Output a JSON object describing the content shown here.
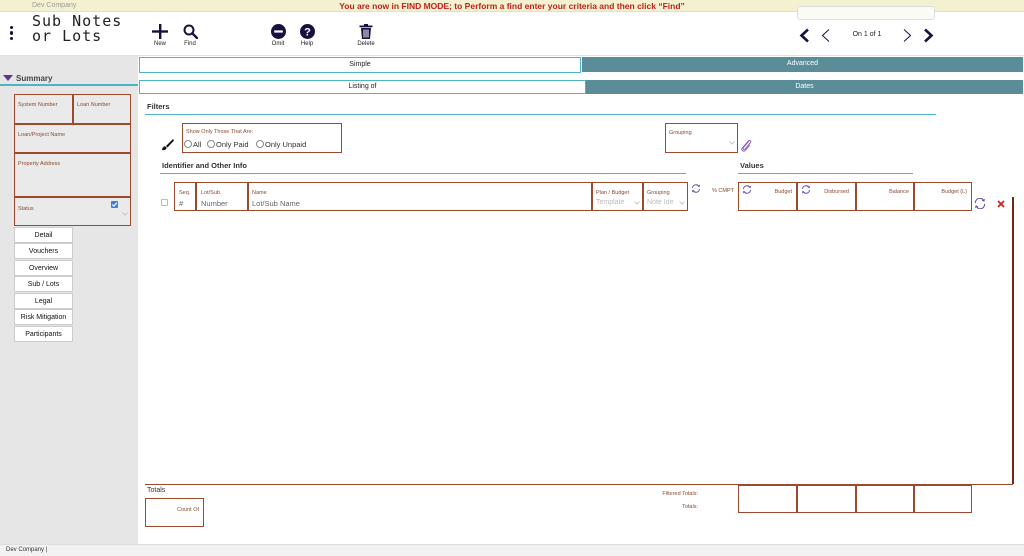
{
  "banner": {
    "company": "Dev Company",
    "find_message": "You are now in FIND MODE; to Perform a find enter your criteria and then click “Find”"
  },
  "toolbar": {
    "title_line1": "Sub Notes",
    "title_line2": "or Lots",
    "new_label": "New",
    "find_label": "Find",
    "omit_label": "Omit",
    "help_label": "Help",
    "delete_label": "Delete",
    "pager_text": "On 1 of 1"
  },
  "sidebar": {
    "summary_label": "Summary",
    "fields": {
      "system_number": "System Number",
      "loan_number": "Loan Number",
      "project_name": "Loan/Project Name",
      "property_address": "Property Address",
      "status": "Status"
    },
    "nav": [
      "Detail",
      "Vouchers",
      "Overview",
      "Sub / Lots",
      "Legal",
      "Risk Mitigation",
      "Participants"
    ]
  },
  "tabs": {
    "simple": "Simple",
    "advanced": "Advanced",
    "listing_of": "Listing of",
    "dates": "Dates"
  },
  "filters": {
    "title": "Filters",
    "show_only_label": "Show Only Those That Are:",
    "options": [
      "All",
      "Only Paid",
      "Only Unpaid"
    ],
    "grouping_label": "Grouping"
  },
  "sections": {
    "identifier": "Identifier and Other Info",
    "values": "Values"
  },
  "columns": {
    "seq": "Seq.",
    "seq_placeholder": "#",
    "lot": "Lot/Sub.",
    "lot_placeholder": "Number",
    "name": "Name",
    "name_placeholder": "Lot/Sub Name",
    "plan": "Plan / Budget",
    "plan_placeholder": "Template",
    "grouping": "Grouping",
    "grouping_placeholder": "Note Ide",
    "cmpt": "% CMPT",
    "budget": "Budget",
    "disbursed": "Disbursed",
    "balance": "Balance",
    "budget_l": "Budget (L)"
  },
  "totals": {
    "label": "Totals",
    "count_of": "Count Of",
    "filtered_totals": "Filtered Totals:",
    "totals": "Totals:"
  },
  "footer": {
    "company": "Dev Company |"
  },
  "colors": {
    "accent_teal": "#4fb3c8",
    "field_border": "#9b4a2e",
    "tab_inactive": "#5a8d98",
    "find_message": "#c02020",
    "icon_dark": "#1a1040"
  }
}
